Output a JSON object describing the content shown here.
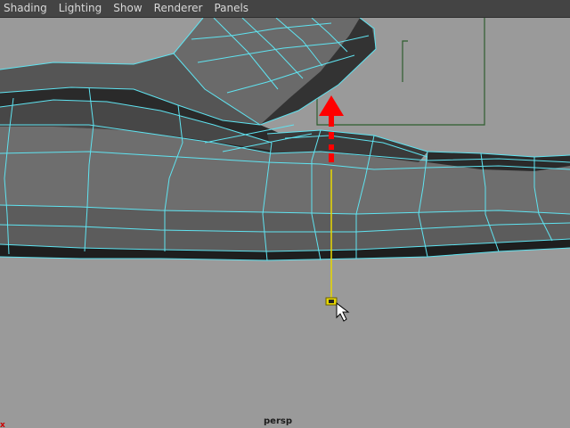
{
  "menubar": {
    "items": [
      {
        "label": "Shading"
      },
      {
        "label": "Lighting"
      },
      {
        "label": "Show"
      },
      {
        "label": "Renderer"
      },
      {
        "label": "Panels"
      }
    ]
  },
  "viewport": {
    "camera": "persp",
    "axis_label": "x",
    "colors": {
      "background": "#9a9a9a",
      "wire": "#5fe3f0",
      "face_dark": "#1e1e1e",
      "face_mid": "#5a5a5a",
      "face_light": "#767676",
      "move_handle": "#ff0000",
      "pivot": "#e8d800",
      "frame": "#2f5d2f"
    },
    "icons": [
      "move-up-arrow-icon",
      "manipulator-pivot-icon",
      "mouse-cursor-icon"
    ]
  }
}
